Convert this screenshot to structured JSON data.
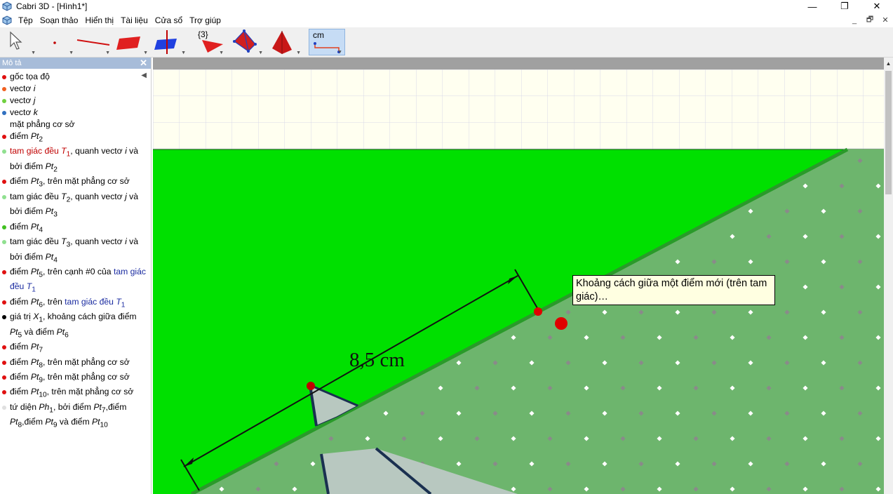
{
  "window": {
    "title": "Cabri 3D - [Hình1*]",
    "controls": {
      "minimize": "—",
      "maximize": "❐",
      "close": "✕"
    }
  },
  "menubar": {
    "items": [
      "Tệp",
      "Soạn thảo",
      "Hiển thị",
      "Tài liệu",
      "Cửa sổ",
      "Trợ giúp"
    ],
    "mdi_controls": [
      "_",
      "🗗",
      "✕"
    ]
  },
  "toolbar": {
    "tools": [
      {
        "name": "pointer-tool",
        "icon": "pointer-icon"
      },
      {
        "name": "point-tool",
        "icon": "point-icon"
      },
      {
        "name": "line-tool",
        "icon": "line-icon"
      },
      {
        "name": "plane-tool",
        "icon": "plane-icon"
      },
      {
        "name": "perpendicular-tool",
        "icon": "perpendicular-plane-icon"
      },
      {
        "name": "polygon-tool",
        "icon": "triangle-icon",
        "badge": "{3}"
      },
      {
        "name": "polyhedron-tool",
        "icon": "tetrahedron-icon"
      },
      {
        "name": "solid-tool",
        "icon": "pyramid-icon"
      },
      {
        "name": "measure-tool",
        "icon": "distance-measure-icon",
        "badge": "cm",
        "active": true
      }
    ]
  },
  "panel": {
    "title": "Mô tả",
    "close_label": "✕",
    "collapse_arrow": "◀",
    "items": [
      {
        "dot": "#e01010",
        "text": "gốc tọa độ"
      },
      {
        "dot": "#f06020",
        "text": "vectơ ",
        "var": "i"
      },
      {
        "dot": "#70d040",
        "text": "vectơ ",
        "var": "j"
      },
      {
        "dot": "#3070c0",
        "text": "vectơ ",
        "var": "k"
      },
      {
        "dot": "",
        "text": "mặt phẳng cơ sở"
      },
      {
        "dot": "#e01010",
        "text": "điểm ",
        "var": "Pt",
        "sub": "2"
      },
      {
        "dot": "#90e090",
        "html": "<span class='red'>tam giác đều <em>T</em><sub>1</sub></span>, quanh vectơ <em>i</em> và bởi điểm <em>Pt</em><sub>2</sub>"
      },
      {
        "dot": "#e01010",
        "html": "điểm <em>Pt</em><sub>3</sub>, trên mặt phẳng cơ sở"
      },
      {
        "dot": "#90e090",
        "html": "tam giác đều <em>T</em><sub>2</sub>, quanh vectơ <em>j</em> và bởi điểm <em>Pt</em><sub>3</sub>"
      },
      {
        "dot": "#40c020",
        "html": "điểm <em>Pt</em><sub>4</sub>"
      },
      {
        "dot": "#90e090",
        "html": "tam giác đều <em>T</em><sub>3</sub>, quanh vectơ <em>i</em> và bởi điểm <em>Pt</em><sub>4</sub>"
      },
      {
        "dot": "#e01010",
        "html": "điểm <em>Pt</em><sub>5</sub>, trên cạnh #0 của <span class='blue'>tam giác đều <em>T</em><sub>1</sub></span>"
      },
      {
        "dot": "#e01010",
        "html": "điểm <em>Pt</em><sub>6</sub>, trên <span class='blue'>tam giác đều <em>T</em><sub>1</sub></span>"
      },
      {
        "dot": "#000000",
        "html": "giá trị <em>X</em><sub>1</sub>, khoảng cách giữa điểm <em>Pt</em><sub>5</sub> và điểm <em>Pt</em><sub>6</sub>"
      },
      {
        "dot": "#e01010",
        "html": "điểm <em>Pt</em><sub>7</sub>"
      },
      {
        "dot": "#e01010",
        "html": "điểm <em>Pt</em><sub>8</sub>, trên mặt phẳng cơ sở"
      },
      {
        "dot": "#e01010",
        "html": "điểm <em>Pt</em><sub>9</sub>, trên mặt phẳng cơ sở"
      },
      {
        "dot": "#e01010",
        "html": "điểm <em>Pt</em><sub>10</sub>, trên mặt phẳng cơ sở"
      },
      {
        "dot": "#e0e0e0",
        "html": "tứ diện <em>Ph</em><sub>1</sub>, bởi điểm <em>Pt</em><sub>7</sub>,điểm <em>Pt</em><sub>8</sub>,điểm <em>Pt</em><sub>9</sub> và điểm <em>Pt</em><sub>10</sub>"
      }
    ]
  },
  "view": {
    "measurement_label": "8,5 cm",
    "tooltip": "Khoảng cách giữa một điểm mới (trên tam giác)…",
    "colors": {
      "grid_bg": "#fffff0",
      "green_plane": "#00e000",
      "base_plane": "#6db56d",
      "point": "#e00000"
    }
  }
}
